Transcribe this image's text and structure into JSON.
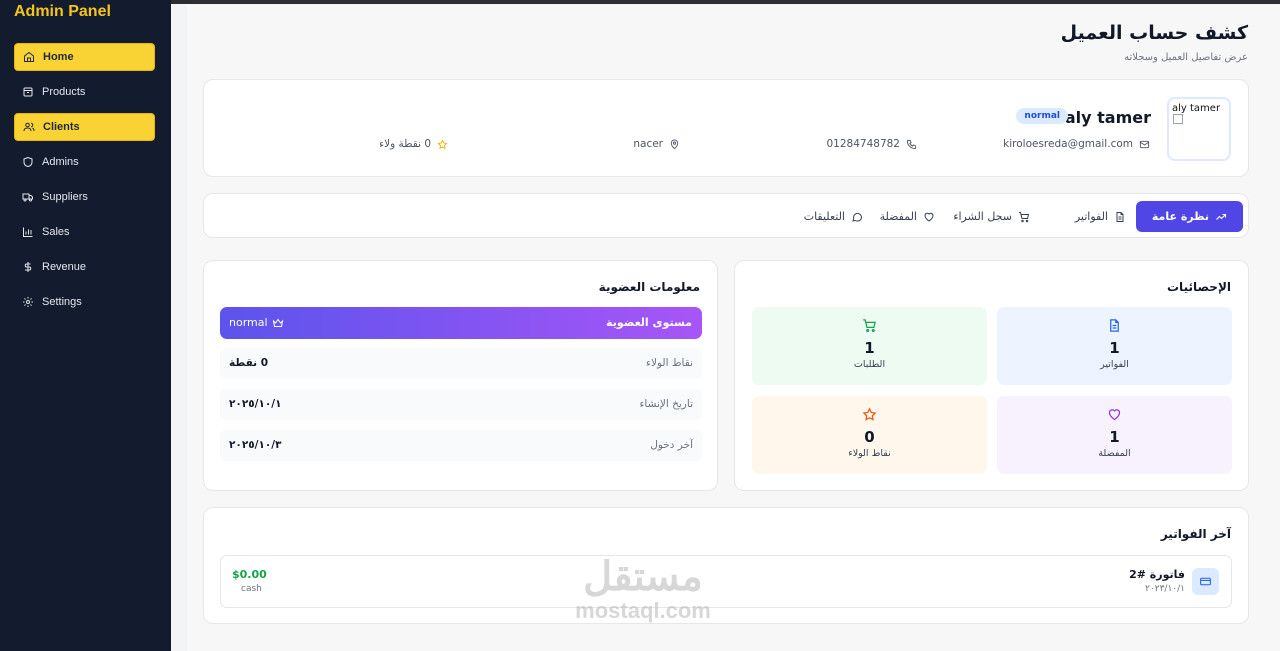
{
  "app": {
    "title": "Admin Panel"
  },
  "sidebar": {
    "items": [
      {
        "label": "Home",
        "icon": "home-icon",
        "active": true
      },
      {
        "label": "Products",
        "icon": "box-icon",
        "active": false
      },
      {
        "label": "Clients",
        "icon": "users-icon",
        "active": true
      },
      {
        "label": "Admins",
        "icon": "shield-icon",
        "active": false
      },
      {
        "label": "Suppliers",
        "icon": "truck-icon",
        "active": false
      },
      {
        "label": "Sales",
        "icon": "bar-chart-icon",
        "active": false
      },
      {
        "label": "Revenue",
        "icon": "dollar-icon",
        "active": false
      },
      {
        "label": "Settings",
        "icon": "gear-icon",
        "active": false
      }
    ]
  },
  "page": {
    "title": "كشف حساب العميل",
    "subtitle": "عرض تفاصيل العميل وسجلاته"
  },
  "profile": {
    "avatar_alt": "aly tamer",
    "name": "aly tamer",
    "level": "normal",
    "email": "kiroloesreda@gmail.com",
    "phone": "01284748782",
    "location": "nacer",
    "points": "0 نقطة ولاء"
  },
  "tabs": [
    {
      "label": "نظرة عامة",
      "icon": "trend-icon",
      "active": true
    },
    {
      "label": "الفواتير",
      "icon": "file-icon",
      "active": false
    },
    {
      "label": "سجل الشراء",
      "icon": "cart-icon",
      "active": false
    },
    {
      "label": "المفضلة",
      "icon": "heart-icon",
      "active": false
    },
    {
      "label": "التعليقات",
      "icon": "comment-icon",
      "active": false
    }
  ],
  "membership": {
    "title": "معلومات العضوية",
    "level_label": "مستوى العضوية",
    "level_value": "normal",
    "rows": [
      {
        "label": "نقاط الولاء",
        "value": "0 نقطة"
      },
      {
        "label": "تاريخ الإنشاء",
        "value": "٢٠٢٥/١٠/١"
      },
      {
        "label": "آخر دخول",
        "value": "٢٠٢٥/١٠/٣"
      }
    ]
  },
  "stats": {
    "title": "الإحصائيات",
    "items": [
      {
        "label": "الفواتير",
        "value": "1",
        "icon": "file-icon",
        "color": "#2563eb",
        "bg": "#eef4ff"
      },
      {
        "label": "الطلبات",
        "value": "1",
        "icon": "cart-icon",
        "color": "#16a34a",
        "bg": "#eefbf2"
      },
      {
        "label": "المفضلة",
        "value": "1",
        "icon": "heart-icon",
        "color": "#9333ea",
        "bg": "#f8f2ff"
      },
      {
        "label": "نقاط الولاء",
        "value": "0",
        "icon": "star-icon",
        "color": "#ea580c",
        "bg": "#fff6ec"
      }
    ]
  },
  "invoices": {
    "title": "آخر الفواتير",
    "items": [
      {
        "title": "فاتورة #2",
        "date": "٢٠٢٣/١٠/١",
        "amount": "$0.00",
        "method": "cash"
      }
    ]
  },
  "watermark": {
    "arabic": "مستقل",
    "latin": "mostaql.com"
  }
}
